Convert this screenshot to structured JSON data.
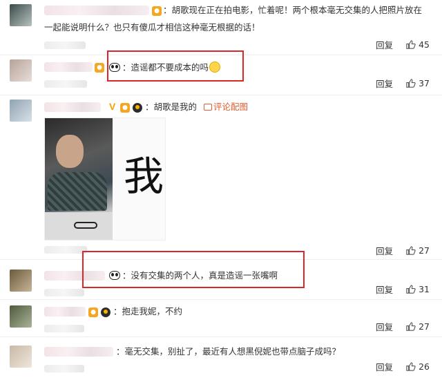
{
  "comments": [
    {
      "text_line1": "：胡歌现在正在拍电影，忙着呢！两个根本毫无交集的人把照片放在",
      "text_line2": "一起能说明什么？也只有傻瓜才相信这种毫无根据的话！",
      "reply": "回复",
      "likes": "45"
    },
    {
      "text": "：造谣都不要成本的吗",
      "reply": "回复",
      "likes": "37"
    },
    {
      "text": "：胡歌是我的",
      "tag": "评论配图",
      "image_char": "我",
      "reply": "回复",
      "likes": "27"
    },
    {
      "text": "：没有交集的两个人，真是造谣一张嘴啊",
      "reply": "回复",
      "likes": "31"
    },
    {
      "text": "：抱走我妮，不约",
      "reply": "回复",
      "likes": "27"
    },
    {
      "text": "：毫无交集，别扯了，最近有人想黑倪妮也带点脑子成吗？",
      "reply": "回复",
      "likes": "26"
    }
  ],
  "colors": {
    "highlight": "#d9262b",
    "link": "#e35c2c",
    "vip": "#f5a623"
  },
  "icons": [
    "thumbs-up-icon",
    "panda-emoji-icon",
    "smile-emoji-icon",
    "picture-icon"
  ]
}
